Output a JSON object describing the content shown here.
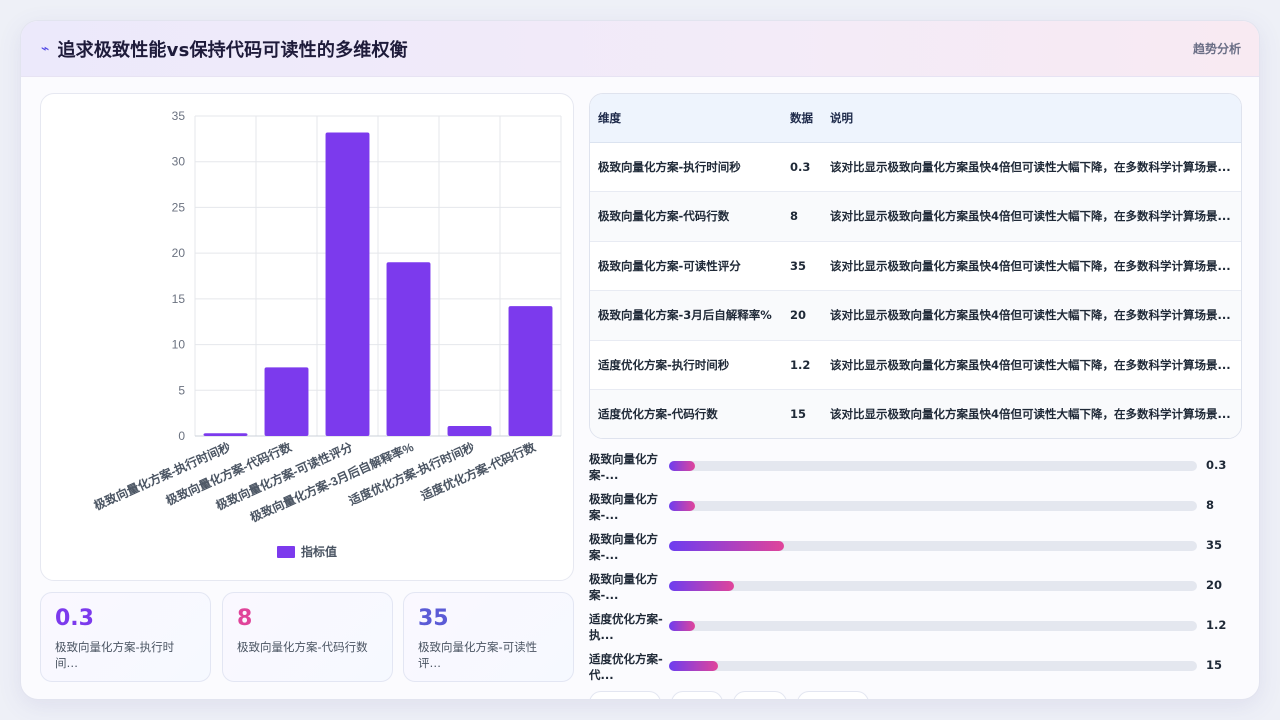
{
  "header": {
    "title": "追求极致性能vs保持代码可读性的多维权衡",
    "tag": "趋势分析"
  },
  "chart_data": {
    "type": "bar",
    "categories": [
      "极致向量化方案-执行时间秒",
      "极致向量化方案-代码行数",
      "极致向量化方案-可读性评分",
      "极致向量化方案-3月后自解释率%",
      "适度优化方案-执行时间秒",
      "适度优化方案-代码行数"
    ],
    "series": [
      {
        "name": "指标值",
        "values": [
          0.3,
          7.5,
          33.2,
          19,
          1.1,
          14.2
        ]
      }
    ],
    "ylim": [
      0,
      35
    ],
    "yticks": [
      0,
      5,
      10,
      15,
      20,
      25,
      30,
      35
    ],
    "grid": true,
    "legend": "bottom",
    "color": "#7c3aed"
  },
  "kpis": [
    {
      "value": "0.3",
      "label": "极致向量化方案-执行时间…",
      "color": "#7c3aed"
    },
    {
      "value": "8",
      "label": "极致向量化方案-代码行数",
      "color": "#e0449a"
    },
    {
      "value": "35",
      "label": "极致向量化方案-可读性评…",
      "color": "#5b5bd6"
    }
  ],
  "table": {
    "headers": [
      "维度",
      "数据",
      "说明"
    ],
    "rows": [
      {
        "dim": "极致向量化方案-执行时间秒",
        "val": "0.3",
        "desc": "该对比显示极致向量化方案虽快4倍但可读性大幅下降，在多数科学计算场景..."
      },
      {
        "dim": "极致向量化方案-代码行数",
        "val": "8",
        "desc": "该对比显示极致向量化方案虽快4倍但可读性大幅下降，在多数科学计算场景..."
      },
      {
        "dim": "极致向量化方案-可读性评分",
        "val": "35",
        "desc": "该对比显示极致向量化方案虽快4倍但可读性大幅下降，在多数科学计算场景..."
      },
      {
        "dim": "极致向量化方案-3月后自解释率%",
        "val": "20",
        "desc": "该对比显示极致向量化方案虽快4倍但可读性大幅下降，在多数科学计算场景..."
      },
      {
        "dim": "适度优化方案-执行时间秒",
        "val": "1.2",
        "desc": "该对比显示极致向量化方案虽快4倍但可读性大幅下降，在多数科学计算场景..."
      },
      {
        "dim": "适度优化方案-代码行数",
        "val": "15",
        "desc": "该对比显示极致向量化方案虽快4倍但可读性大幅下降，在多数科学计算场景..."
      }
    ]
  },
  "progress": [
    {
      "label": "极致向量化方案-...",
      "value": "0.3",
      "fraction": 0.05
    },
    {
      "label": "极致向量化方案-...",
      "value": "8",
      "fraction": 0.05
    },
    {
      "label": "极致向量化方案-...",
      "value": "35",
      "fraction": 0.217
    },
    {
      "label": "极致向量化方案-...",
      "value": "20",
      "fraction": 0.124
    },
    {
      "label": "适度优化方案-执...",
      "value": "1.2",
      "fraction": 0.05
    },
    {
      "label": "适度优化方案-代...",
      "value": "15",
      "fraction": 0.093
    }
  ]
}
